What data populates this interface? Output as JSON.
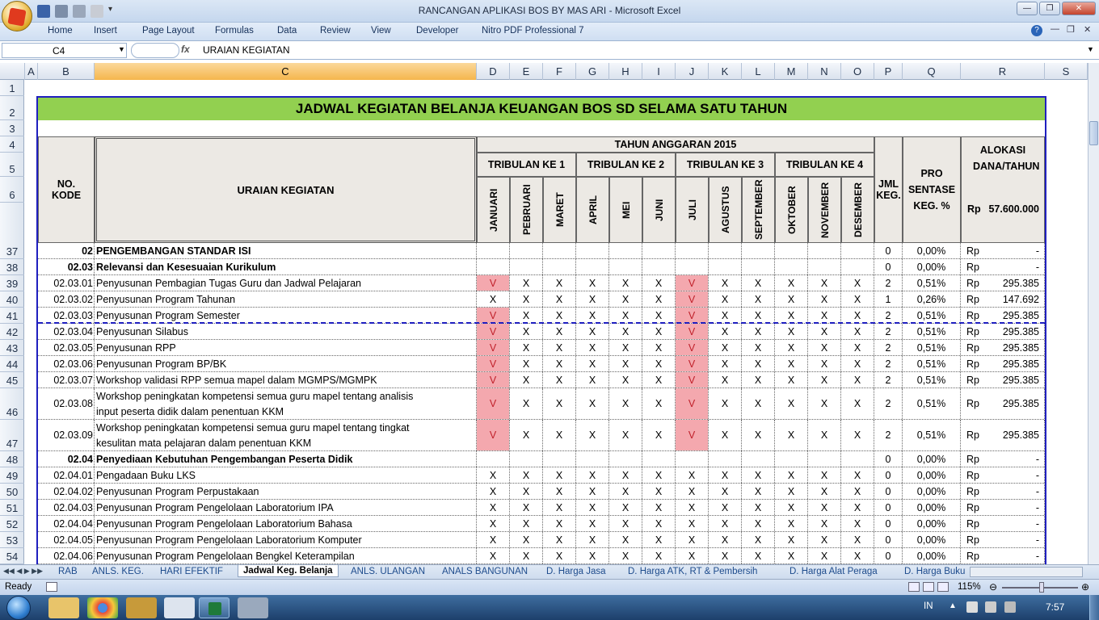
{
  "window": {
    "title": "RANCANGAN APLIKASI BOS BY MAS ARI - Microsoft Excel",
    "buttons": [
      "minimize",
      "restore",
      "close"
    ]
  },
  "ribbon": {
    "tabs": [
      "Home",
      "Insert",
      "Page Layout",
      "Formulas",
      "Data",
      "Review",
      "View",
      "Developer",
      "Nitro PDF Professional 7"
    ]
  },
  "formula_bar": {
    "name_box": "C4",
    "fx": "fx",
    "content": "URAIAN KEGIATAN"
  },
  "columns": [
    "A",
    "B",
    "C",
    "D",
    "E",
    "F",
    "G",
    "H",
    "I",
    "J",
    "K",
    "L",
    "M",
    "N",
    "O",
    "P",
    "Q",
    "R",
    "S"
  ],
  "selected_column": "C",
  "header_rows": [
    "1",
    "2",
    "3",
    "4",
    "5",
    "6"
  ],
  "sheet": {
    "title": "JADWAL KEGIATAN BELANJA KEUANGAN BOS SD SELAMA SATU TAHUN",
    "no_kode": "NO. KODE",
    "uraian": "URAIAN KEGIATAN",
    "tahun_anggaran": "TAHUN ANGGARAN 2015",
    "tribulan": [
      "TRIBULAN KE 1",
      "TRIBULAN KE 2",
      "TRIBULAN KE 3",
      "TRIBULAN KE 4"
    ],
    "months": [
      "JANUARI",
      "PEBRUARI",
      "MARET",
      "APRIL",
      "MEI",
      "JUNI",
      "JULI",
      "AGUSTUS",
      "SEPTEMBER",
      "OKTOBER",
      "NOVEMBER",
      "DESEMBER"
    ],
    "jml_keg": "JML KEG.",
    "pro_sentase": "PRO SENTASE KEG. %",
    "alokasi": "ALOKASI DANA/TAHUN",
    "alokasi_rp": "Rp",
    "alokasi_total": "57.600.000"
  },
  "rows": [
    {
      "num": "37",
      "code": "02",
      "desc": "PENGEMBANGAN STANDAR ISI",
      "bold": true,
      "marks": "",
      "jml": "0",
      "pct": "0,00%",
      "rp": "Rp",
      "amt": "-"
    },
    {
      "num": "38",
      "code": "02.03",
      "desc": "Relevansi dan Kesesuaian Kurikulum",
      "bold": true,
      "marks": "",
      "jml": "0",
      "pct": "0,00%",
      "rp": "Rp",
      "amt": "-"
    },
    {
      "num": "39",
      "code": "02.03.01",
      "desc": "Penyusunan Pembagian Tugas Guru dan Jadwal Pelajaran",
      "bold": false,
      "marks": "VXXXXXVXXXXX",
      "jml": "2",
      "pct": "0,51%",
      "rp": "Rp",
      "amt": "295.385"
    },
    {
      "num": "40",
      "code": "02.03.02",
      "desc": "Penyusunan Program Tahunan",
      "bold": false,
      "marks": "XXXXXXVXXXXX",
      "jml": "1",
      "pct": "0,26%",
      "rp": "Rp",
      "amt": "147.692"
    },
    {
      "num": "41",
      "code": "02.03.03",
      "desc": "Penyusunan Program Semester",
      "bold": false,
      "marks": "VXXXXXVXXXXX",
      "jml": "2",
      "pct": "0,51%",
      "rp": "Rp",
      "amt": "295.385"
    },
    {
      "num": "42",
      "code": "02.03.04",
      "desc": "Penyusunan Silabus",
      "bold": false,
      "marks": "VXXXXXVXXXXX",
      "jml": "2",
      "pct": "0,51%",
      "rp": "Rp",
      "amt": "295.385"
    },
    {
      "num": "43",
      "code": "02.03.05",
      "desc": "Penyusunan RPP",
      "bold": false,
      "marks": "VXXXXXVXXXXX",
      "jml": "2",
      "pct": "0,51%",
      "rp": "Rp",
      "amt": "295.385"
    },
    {
      "num": "44",
      "code": "02.03.06",
      "desc": "Penyusunan Program BP/BK",
      "bold": false,
      "marks": "VXXXXXVXXXXX",
      "jml": "2",
      "pct": "0,51%",
      "rp": "Rp",
      "amt": "295.385"
    },
    {
      "num": "45",
      "code": "02.03.07",
      "desc": "Workshop validasi RPP semua mapel dalam MGMPS/MGMPK",
      "bold": false,
      "marks": "VXXXXXVXXXXX",
      "jml": "2",
      "pct": "0,51%",
      "rp": "Rp",
      "amt": "295.385"
    },
    {
      "num": "46",
      "code": "02.03.08",
      "desc": "Workshop peningkatan kompetensi semua guru mapel tentang analisis",
      "desc2": "input peserta didik dalam penentuan KKM",
      "bold": false,
      "marks": "VXXXXXVXXXXX",
      "jml": "2",
      "pct": "0,51%",
      "rp": "Rp",
      "amt": "295.385"
    },
    {
      "num": "47",
      "code": "02.03.09",
      "desc": "Workshop peningkatan kompetensi semua guru mapel tentang tingkat",
      "desc2": "kesulitan mata pelajaran dalam penentuan KKM",
      "bold": false,
      "marks": "VXXXXXVXXXXX",
      "jml": "2",
      "pct": "0,51%",
      "rp": "Rp",
      "amt": "295.385"
    },
    {
      "num": "48",
      "code": "02.04",
      "desc": "Penyediaan Kebutuhan Pengembangan Peserta Didik",
      "bold": true,
      "marks": "",
      "jml": "0",
      "pct": "0,00%",
      "rp": "Rp",
      "amt": "-"
    },
    {
      "num": "49",
      "code": "02.04.01",
      "desc": "Pengadaan Buku LKS",
      "bold": false,
      "marks": "XXXXXXXXXXXX",
      "jml": "0",
      "pct": "0,00%",
      "rp": "Rp",
      "amt": "-"
    },
    {
      "num": "50",
      "code": "02.04.02",
      "desc": "Penyusunan Program Perpustakaan",
      "bold": false,
      "marks": "XXXXXXXXXXXX",
      "jml": "0",
      "pct": "0,00%",
      "rp": "Rp",
      "amt": "-"
    },
    {
      "num": "51",
      "code": "02.04.03",
      "desc": "Penyusunan Program Pengelolaan Laboratorium IPA",
      "bold": false,
      "marks": "XXXXXXXXXXXX",
      "jml": "0",
      "pct": "0,00%",
      "rp": "Rp",
      "amt": "-"
    },
    {
      "num": "52",
      "code": "02.04.04",
      "desc": "Penyusunan Program Pengelolaan Laboratorium Bahasa",
      "bold": false,
      "marks": "XXXXXXXXXXXX",
      "jml": "0",
      "pct": "0,00%",
      "rp": "Rp",
      "amt": "-"
    },
    {
      "num": "53",
      "code": "02.04.05",
      "desc": "Penyusunan Program Pengelolaan Laboratorium Komputer",
      "bold": false,
      "marks": "XXXXXXXXXXXX",
      "jml": "0",
      "pct": "0,00%",
      "rp": "Rp",
      "amt": "-"
    },
    {
      "num": "54",
      "code": "02.04.06",
      "desc": "Penyusunan Program Pengelolaan Bengkel Keterampilan",
      "bold": false,
      "marks": "XXXXXXXXXXXX",
      "jml": "0",
      "pct": "0,00%",
      "rp": "Rp",
      "amt": "-"
    }
  ],
  "sheet_tabs": [
    "RAB",
    "ANLS. KEG.",
    "HARI EFEKTIF",
    "Jadwal Keg. Belanja",
    "ANLS. ULANGAN",
    "ANALS BANGUNAN",
    "D. Harga Jasa",
    "D. Harga ATK, RT & Pembersih",
    "D. Harga Alat Peraga",
    "D. Harga Buku",
    "D. Ha"
  ],
  "active_sheet_tab": "Jadwal Keg. Belanja",
  "status": {
    "left": "Ready",
    "zoom": "115%"
  },
  "taskbar": {
    "lang": "IN",
    "time": "7:57"
  },
  "colors": {
    "title_bg": "#92d050",
    "mark_red_bg": "#f4a8ae",
    "mark_red_fg": "#c0202a",
    "border_blue": "#1f1fbf"
  }
}
